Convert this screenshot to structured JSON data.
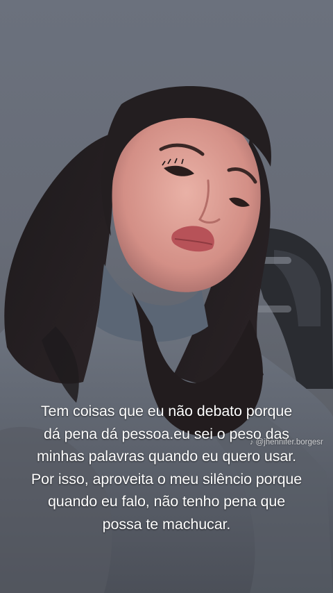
{
  "caption": {
    "lines": [
      "Tem coisas que eu não debato  porque",
      "dá pena dá pessoa.eu sei o peso das",
      "minhas palavras quando eu quero usar.",
      "Por isso, aproveita o meu silêncio porque",
      "quando eu falo, não tenho pena que",
      "possa te machucar."
    ]
  },
  "watermark": {
    "icon": "tiktok-icon",
    "handle": "@jhennifer.borgesr"
  },
  "colors": {
    "background": "#6b717d",
    "caption_text": "#ffffff"
  }
}
